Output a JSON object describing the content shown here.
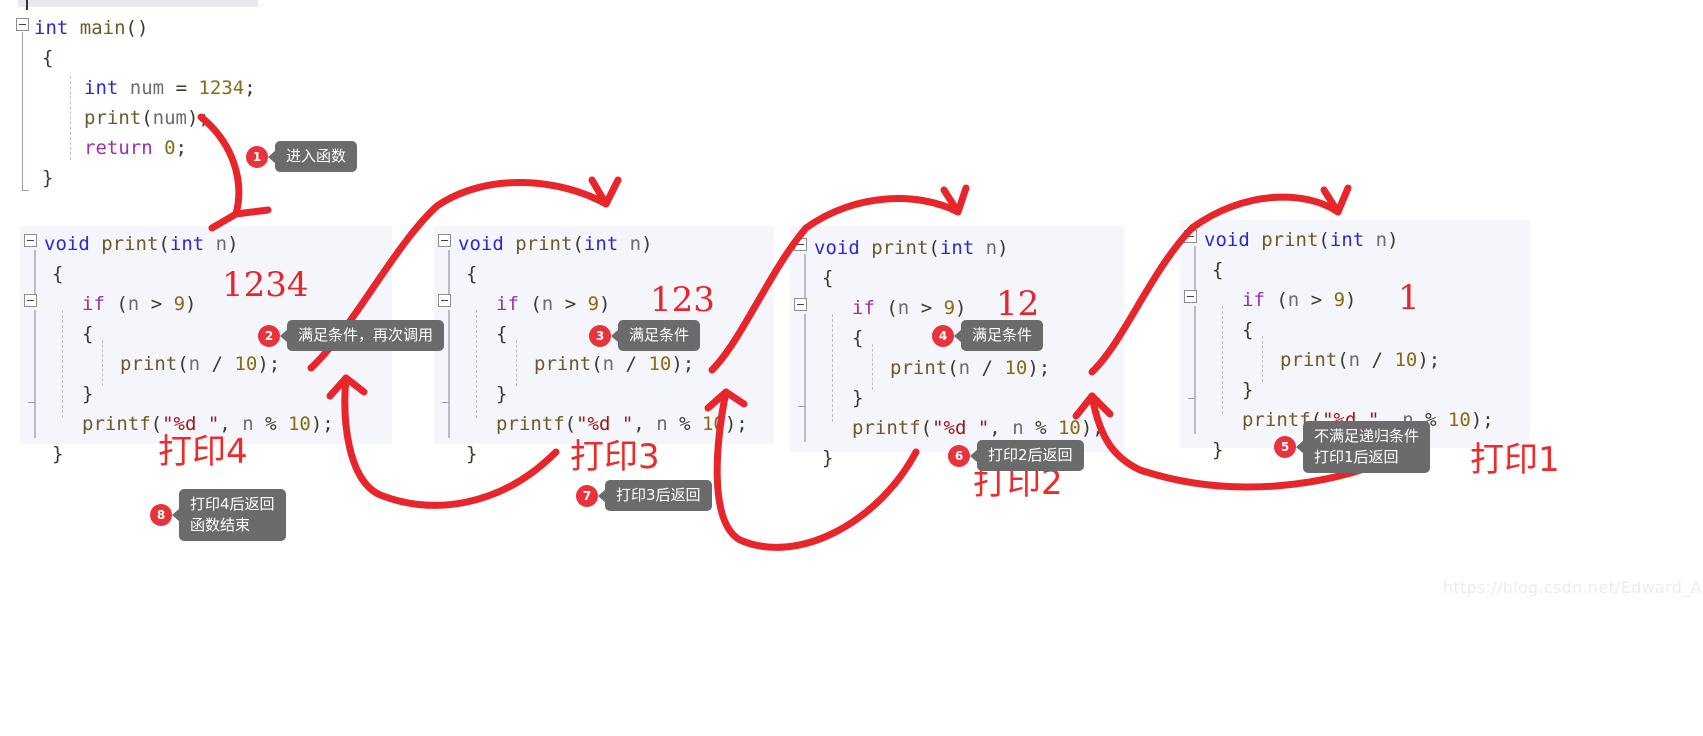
{
  "watermark": "https://blog.csdn.net/Edward_Asia",
  "main_block": {
    "lines": [
      "int main()",
      "{",
      "    int num = 1234;",
      "    print(num);",
      "    return 0;",
      "}"
    ],
    "keyword": "int",
    "keyword2": "return",
    "fn": "main",
    "num": "1234",
    "zero": "0"
  },
  "blocks": [
    {
      "id": "block-1",
      "lines": [
        "void print(int n)",
        "{",
        "    if (n > 9)",
        "    {",
        "        print(n / 10);",
        "    }",
        "    printf(\"%d \", n % 10);",
        "}"
      ],
      "arg_value": "1234",
      "print_label": "打印4"
    },
    {
      "id": "block-2",
      "lines": [
        "void print(int n)",
        "{",
        "    if (n > 9)",
        "    {",
        "        print(n / 10);",
        "    }",
        "    printf(\"%d \", n % 10);",
        "}"
      ],
      "arg_value": "123",
      "print_label": "打印3"
    },
    {
      "id": "block-3",
      "lines": [
        "void print(int n)",
        "{",
        "    if (n > 9)",
        "    {",
        "        print(n / 10);",
        "    }",
        "    printf(\"%d \", n % 10);",
        "}"
      ],
      "arg_value": "12",
      "print_label": "打印2"
    },
    {
      "id": "block-4",
      "lines": [
        "void print(int n)",
        "{",
        "    if (n > 9)",
        "    {",
        "        print(n / 10);",
        "    }",
        "    printf(\"%d \", n % 10);",
        "}"
      ],
      "arg_value": "1",
      "print_label": "打印1"
    }
  ],
  "callouts": [
    {
      "num": "1",
      "text": "进入函数"
    },
    {
      "num": "2",
      "text": "满足条件，再次调用"
    },
    {
      "num": "3",
      "text": "满足条件"
    },
    {
      "num": "4",
      "text": "满足条件"
    },
    {
      "num": "5",
      "text": "不满足递归条件\n打印1后返回"
    },
    {
      "num": "6",
      "text": "打印2后返回"
    },
    {
      "num": "7",
      "text": "打印3后返回"
    },
    {
      "num": "8",
      "text": "打印4后返回\n函数结束"
    }
  ],
  "code_tokens": {
    "void": "void",
    "int": "int",
    "if": "if",
    "print": "print",
    "printf": "printf",
    "fmt": "\"%d \"",
    "n": "n"
  },
  "colors": {
    "accent_red": "#e8323c",
    "hand_red": "#ee2a2a",
    "tip_gray": "#6b6b6b",
    "code_bg": "#f4f6fb",
    "keyword_blue": "#2b26d6",
    "keyword_purple": "#9b2fae",
    "string_red": "#a31515"
  }
}
